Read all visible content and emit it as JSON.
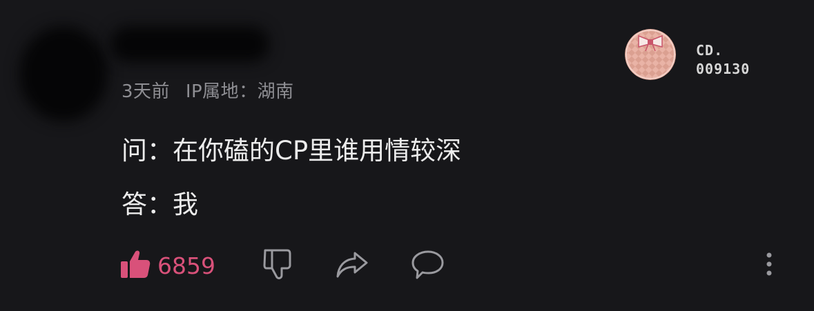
{
  "comment": {
    "meta": {
      "time": "3天前",
      "ip_location": "IP属地：湖南"
    },
    "content": {
      "question": "问：在你磕的CP里谁用情较深",
      "answer": "答：我"
    }
  },
  "badge": {
    "line1": "CD.",
    "line2": "009130"
  },
  "actions": {
    "like_count": "6859",
    "icons": {
      "like": "thumbs-up-icon",
      "dislike": "thumbs-down-icon",
      "share": "share-icon",
      "comment": "comment-icon",
      "more": "more-vertical-icon"
    }
  },
  "colors": {
    "background": "#17171a",
    "text_primary": "#ececec",
    "text_secondary": "#8e8e93",
    "like_active": "#d9517a",
    "icon_gray": "#9a9a9f"
  }
}
